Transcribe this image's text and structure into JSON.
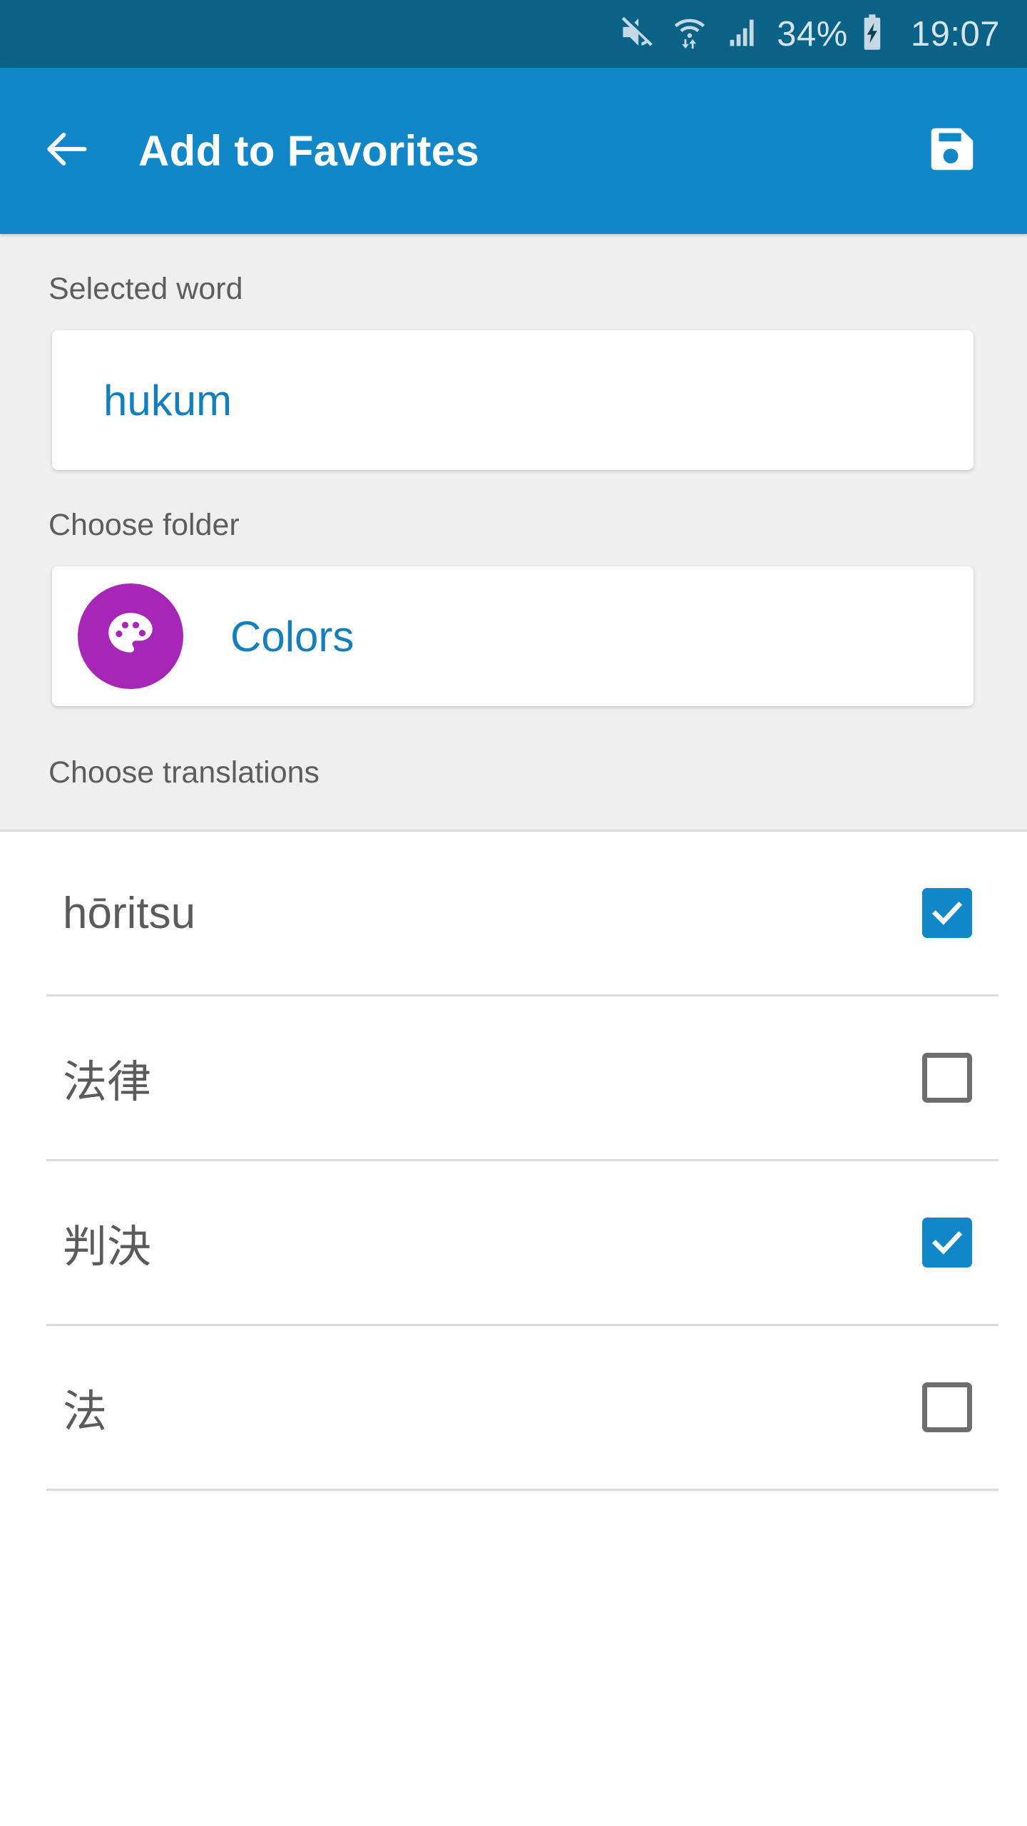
{
  "status_bar": {
    "icons": [
      "mute-icon",
      "wifi-icon",
      "signal-icon"
    ],
    "battery_percent": "34%",
    "battery_state": "charging",
    "clock": "19:07"
  },
  "app_bar": {
    "back_icon": "back-arrow-icon",
    "title": "Add to Favorites",
    "save_icon": "save-floppy-icon"
  },
  "form": {
    "selected_word_label": "Selected word",
    "selected_word_value": "hukum",
    "choose_folder_label": "Choose folder",
    "folder": {
      "name": "Colors",
      "icon": "palette-icon",
      "color": "#a626b8"
    },
    "choose_translations_label": "Choose translations"
  },
  "translations": [
    {
      "text": "hōritsu",
      "checked": true,
      "script": "latin"
    },
    {
      "text": "法律",
      "checked": false,
      "script": "cjk"
    },
    {
      "text": "判決",
      "checked": true,
      "script": "cjk"
    },
    {
      "text": "法",
      "checked": false,
      "script": "cjk"
    }
  ],
  "colors": {
    "status_bar": "#0a6287",
    "app_bar": "#1287c8",
    "accent": "#1287c8",
    "form_background": "#efefef",
    "link_text": "#1380bd",
    "body_text": "#5b5b5b",
    "label_text": "#5d5d5d",
    "folder_accent": "#a626b8",
    "divider": "#dcdcdc"
  }
}
